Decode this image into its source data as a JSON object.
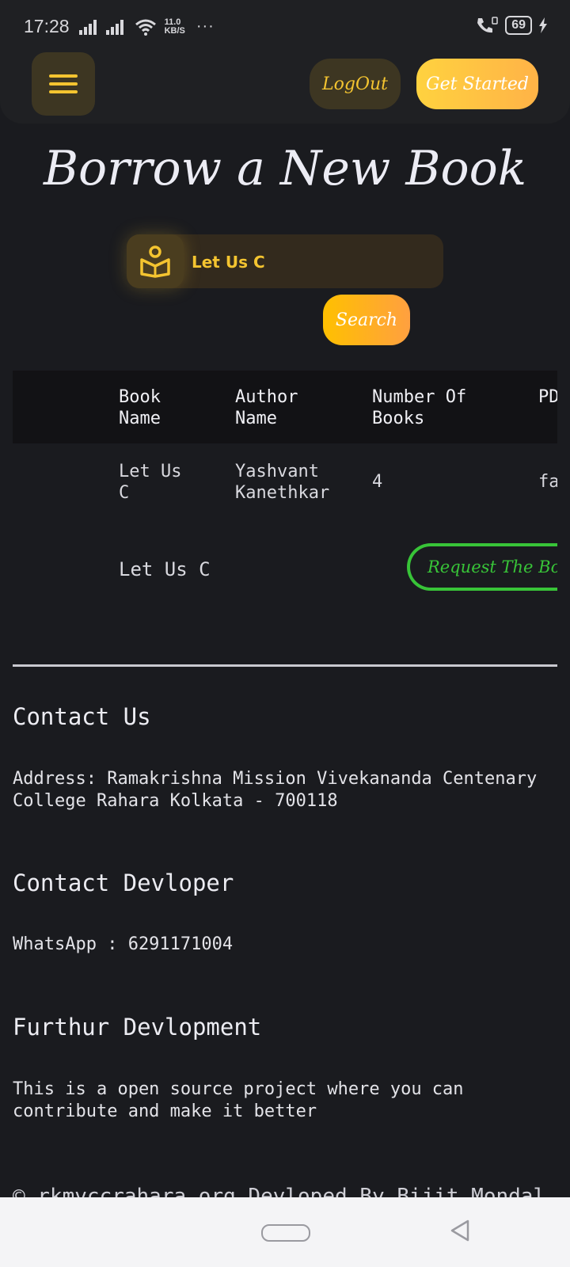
{
  "status_bar": {
    "time": "17:28",
    "net_speed_value": "11.0",
    "net_speed_unit": "KB/S",
    "dots": "···",
    "battery": "69"
  },
  "navbar": {
    "logout_label": "LogOut",
    "get_started_label": "Get Started"
  },
  "page": {
    "title": "Borrow a New Book"
  },
  "search": {
    "value": "Let Us C",
    "button_label": "Search"
  },
  "table": {
    "headers": [
      "Book\nName",
      "Author\nName",
      "Number Of\nBooks",
      "PD"
    ],
    "row": [
      "Let Us\nC",
      "Yashvant\nKanethkar",
      "4",
      "fa"
    ],
    "book_title": "Let Us C",
    "request_label": "Request The Book"
  },
  "footer": {
    "contact_heading": "Contact Us",
    "address": "Address: Ramakrishna Mission Vivekananda Centenary College Rahara Kolkata - 700118",
    "developer_heading": "Contact Devloper",
    "whatsapp": "WhatsApp : 6291171004",
    "further_heading": "Furthur Devlopment",
    "further_text": "This is a open source project where you can contribute and make it better",
    "copyright": "© rkmvccrahara.org Devloped By Bijit Mondal"
  },
  "colors": {
    "accent": "#f4c430",
    "background": "#1a1b1f",
    "request_green": "#38c438"
  }
}
